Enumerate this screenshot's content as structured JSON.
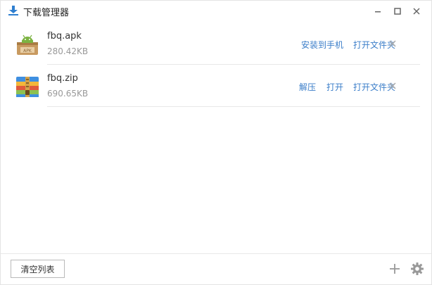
{
  "window": {
    "title": "下载管理器",
    "controls": {
      "minimize_icon": "minimize-icon",
      "maximize_icon": "maximize-icon",
      "close_icon": "close-icon"
    }
  },
  "downloads": [
    {
      "name": "fbq.apk",
      "size": "280.42KB",
      "icon": "apk-file-icon",
      "actions": [
        "安装到手机",
        "打开文件夹"
      ]
    },
    {
      "name": "fbq.zip",
      "size": "690.65KB",
      "icon": "zip-archive-icon",
      "actions": [
        "解压",
        "打开",
        "打开文件夹"
      ]
    }
  ],
  "footer": {
    "clear_label": "清空列表",
    "add_icon": "plus-icon",
    "settings_icon": "gear-icon"
  },
  "colors": {
    "accent": "#3b7ec9",
    "icon_blue": "#2f7fd0",
    "muted_text": "#999999"
  }
}
